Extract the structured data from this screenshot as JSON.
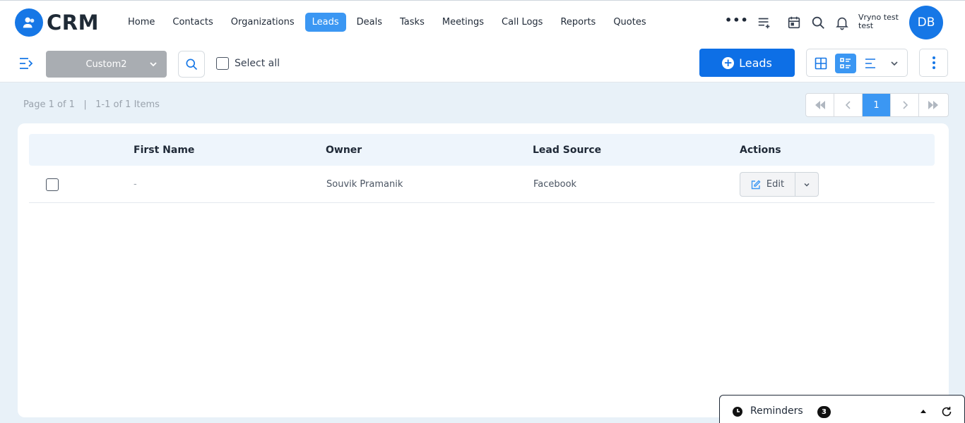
{
  "app": {
    "logo_text": "CRM"
  },
  "nav": {
    "items": [
      {
        "label": "Home"
      },
      {
        "label": "Contacts"
      },
      {
        "label": "Organizations"
      },
      {
        "label": "Leads",
        "active": true
      },
      {
        "label": "Deals"
      },
      {
        "label": "Tasks"
      },
      {
        "label": "Meetings"
      },
      {
        "label": "Call Logs"
      },
      {
        "label": "Reports"
      },
      {
        "label": "Quotes"
      }
    ],
    "more_label": "•••"
  },
  "user": {
    "name": "Vryno test test",
    "initials": "DB"
  },
  "toolbar": {
    "custom_view": "Custom2",
    "select_all_label": "Select all",
    "add_button_label": "Leads"
  },
  "pagination": {
    "page_info": "Page 1 of 1",
    "items_info": "1-1 of 1 Items",
    "current_page": "1"
  },
  "table": {
    "columns": [
      "First Name",
      "Owner",
      "Lead Source",
      "Actions"
    ],
    "rows": [
      {
        "first_name": "-",
        "owner": "Souvik Pramanik",
        "lead_source": "Facebook",
        "action_label": "Edit"
      }
    ]
  },
  "reminders": {
    "label": "Reminders",
    "count": "3"
  },
  "colors": {
    "primary": "#0d6fe6",
    "accent": "#3b97f3",
    "view_select_bg": "#a9adb2"
  }
}
